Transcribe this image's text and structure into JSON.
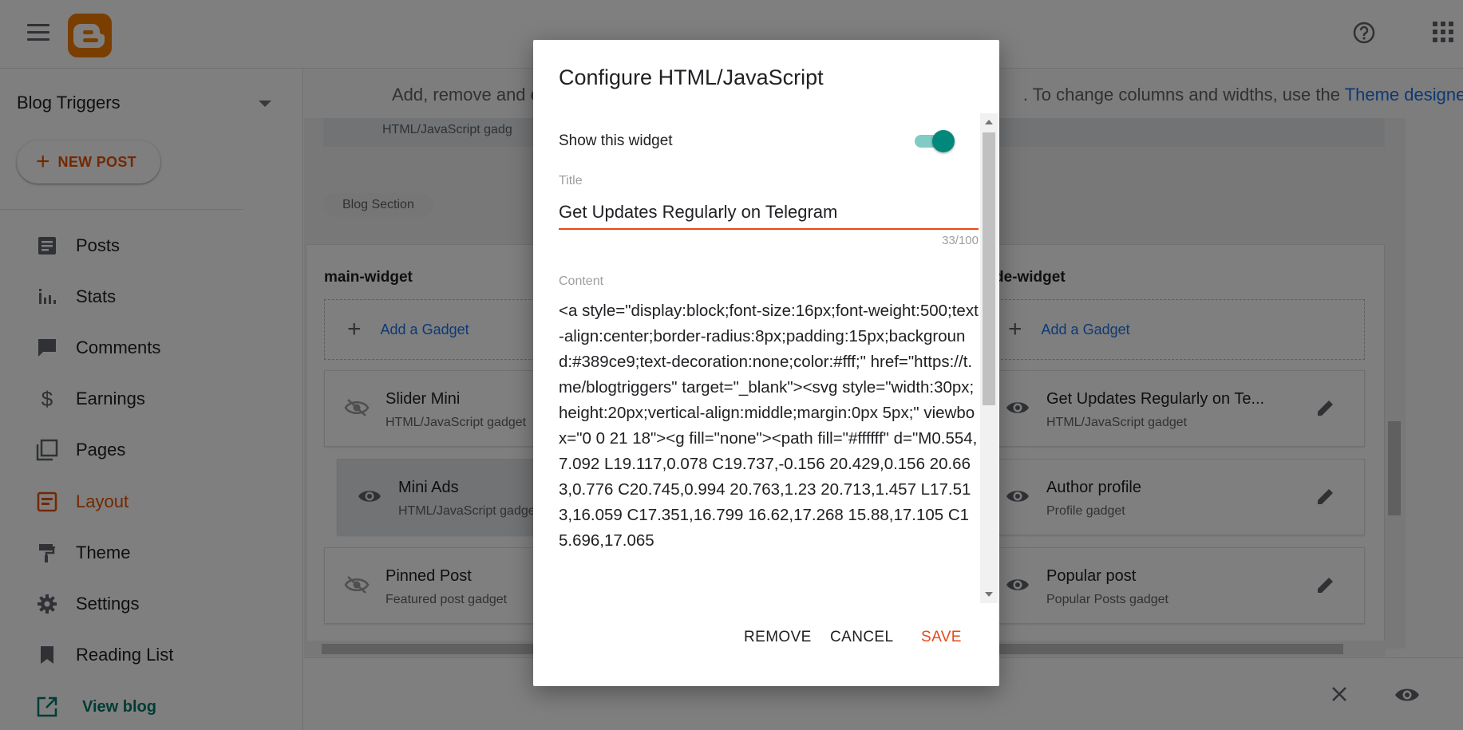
{
  "app": {
    "brand_color": "#f57c00",
    "accent_color": "#e65100",
    "save_color": "#e64a19"
  },
  "sidebar": {
    "blog_name": "Blog Triggers",
    "new_post_label": "NEW POST",
    "items": [
      {
        "label": "Posts",
        "icon": "posts-icon"
      },
      {
        "label": "Stats",
        "icon": "stats-icon"
      },
      {
        "label": "Comments",
        "icon": "comments-icon"
      },
      {
        "label": "Earnings",
        "icon": "earnings-icon"
      },
      {
        "label": "Pages",
        "icon": "pages-icon"
      },
      {
        "label": "Layout",
        "icon": "layout-icon",
        "active": true
      },
      {
        "label": "Theme",
        "icon": "theme-icon"
      },
      {
        "label": "Settings",
        "icon": "settings-icon"
      },
      {
        "label": "Reading List",
        "icon": "bookmark-icon"
      }
    ],
    "view_blog_label": "View blog"
  },
  "main": {
    "info_prefix": "Add, remove and e",
    "info_suffix": ". To change columns and widths, use the ",
    "info_link": "Theme designer",
    "info_end": ".",
    "top_stub_text": "HTML/JavaScript gadg",
    "section_chip": "Blog Section",
    "left_column": {
      "title": "main-widget",
      "add_gadget": "Add a Gadget",
      "gadgets": [
        {
          "name": "Slider Mini",
          "type": "HTML/JavaScript gadget"
        },
        {
          "name": "Mini Ads",
          "type": "HTML/JavaScript gadge"
        },
        {
          "name": "Pinned Post",
          "type": "Featured post gadget"
        }
      ]
    },
    "right_column": {
      "title": "de-widget",
      "add_gadget": "Add a Gadget",
      "gadgets": [
        {
          "name": "Get Updates Regularly on Te...",
          "type": "HTML/JavaScript gadget"
        },
        {
          "name": "Author profile",
          "type": "Profile gadget"
        },
        {
          "name": "Popular post",
          "type": "Popular Posts gadget"
        }
      ]
    }
  },
  "dialog": {
    "title": "Configure HTML/JavaScript",
    "show_widget_label": "Show this widget",
    "show_widget_on": true,
    "title_label": "Title",
    "title_value": "Get Updates Regularly on Telegram",
    "char_count": "33/100",
    "content_label": "Content",
    "content_value": "<a style=\"display:block;font-size:16px;font-weight:500;text-align:center;border-radius:8px;padding:15px;background:#389ce9;text-decoration:none;color:#fff;\" href=\"https://t.me/blogtriggers\" target=\"_blank\"><svg style=\"width:30px;height:20px;vertical-align:middle;margin:0px 5px;\" viewbox=\"0 0 21 18\"><g fill=\"none\"><path fill=\"#ffffff\" d=\"M0.554,7.092 L19.117,0.078 C19.737,-0.156 20.429,0.156 20.663,0.776 C20.745,0.994 20.763,1.23 20.713,1.457 L17.513,16.059 C17.351,16.799 16.62,17.268 15.88,17.105 C15.696,17.065",
    "remove_label": "REMOVE",
    "cancel_label": "CANCEL",
    "save_label": "SAVE"
  }
}
